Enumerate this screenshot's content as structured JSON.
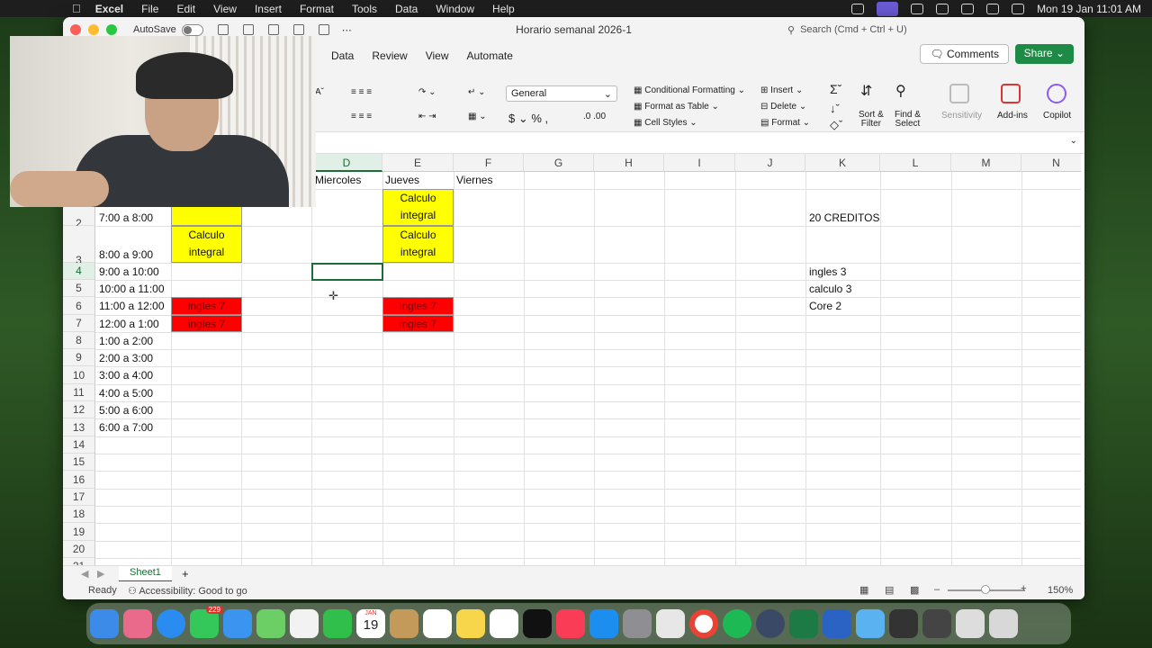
{
  "menubar": {
    "app": "Excel",
    "items": [
      "File",
      "Edit",
      "View",
      "Insert",
      "Format",
      "Tools",
      "Data",
      "Window",
      "Help"
    ],
    "clock": "Mon 19 Jan  11:01 AM"
  },
  "window": {
    "autosave_label": "AutoSave",
    "title": "Horario semanal 2026-1",
    "search_placeholder": "Search (Cmd + Ctrl + U)",
    "comments_label": "Comments",
    "share_label": "Share"
  },
  "ribbon": {
    "tabs": [
      "s",
      "Data",
      "Review",
      "View",
      "Automate"
    ],
    "number_format": "General",
    "conditional_formatting": "Conditional Formatting",
    "format_as_table": "Format as Table",
    "cell_styles": "Cell Styles",
    "insert": "Insert",
    "delete": "Delete",
    "format": "Format",
    "sort_filter": "Sort &\nFilter",
    "sort_filter_l1": "Sort &",
    "sort_filter_l2": "Filter",
    "find_select_l1": "Find &",
    "find_select_l2": "Select",
    "sensitivity": "Sensitivity",
    "addins": "Add-ins",
    "copilot": "Copilot"
  },
  "grid": {
    "columns": [
      "D",
      "E",
      "F",
      "G",
      "H",
      "I",
      "J",
      "K",
      "L",
      "M",
      "N"
    ],
    "selected_column": "D",
    "rows": [
      "2",
      "3",
      "4",
      "5",
      "6",
      "7",
      "8",
      "9",
      "10",
      "11",
      "12",
      "13",
      "14",
      "15",
      "16",
      "17",
      "18",
      "19",
      "20",
      "21"
    ],
    "selected_row": "4",
    "header_row": {
      "d": "Miercoles",
      "e": "Jueves",
      "f": "Viernes"
    },
    "times": [
      "7:00 a 8:00",
      "8:00 a 9:00",
      "9:00 a 10:00",
      "10:00 a 11:00",
      "11:00 a 12:00",
      "12:00 a 1:00",
      "1:00 a 2:00",
      "2:00 a 3:00",
      "3:00 a 4:00",
      "4:00 a 5:00",
      "5:00 a 6:00",
      "6:00 a 7:00"
    ],
    "b2_partial": "integral",
    "b3": "Calculo integral",
    "e1": "Calculo integral",
    "e3": "Calculo integral",
    "ingles7": "ingles 7",
    "k_notes": [
      "20 CREDITOS",
      "ingles 3",
      "calculo 3",
      "Core 2"
    ]
  },
  "sheet_tabs": {
    "sheet1": "Sheet1",
    "add": "+"
  },
  "status": {
    "ready": "Ready",
    "accessibility": "Accessibility: Good to go",
    "zoom": "150%"
  },
  "dock": {
    "messages_badge": "229",
    "calendar_month": "JAN",
    "calendar_day": "19"
  },
  "colors": {
    "excel_green": "#1d6b38",
    "share_green": "#1d8a45",
    "yellow_fill": "#ffff00",
    "red_fill": "#ff0000"
  }
}
